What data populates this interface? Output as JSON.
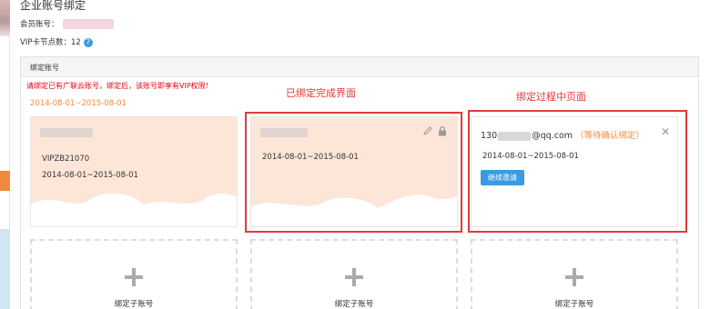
{
  "page_title": "企业账号绑定",
  "member": {
    "label": "会员账号："
  },
  "vip": {
    "label": "VIP卡节点数：12"
  },
  "panel": {
    "header": "绑定账号",
    "notice": "请绑定已有广联云账号，绑定后，该账号即享有VIP权限！",
    "range": "2014-08-01~2015-08-01"
  },
  "cards": {
    "vip_card": {
      "id": "VIPZB21070",
      "range": "2014-08-01~2015-08-01"
    },
    "bound_card": {
      "range": "2014-08-01~2015-08-01"
    },
    "pending_card": {
      "email_prefix": "130",
      "email_suffix": "@qq.com",
      "status": "（等待确认绑定）",
      "range": "2014-08-01~2015-08-01",
      "button": "继续邀请",
      "close": "✕"
    }
  },
  "add_cards": [
    {
      "label": "绑定子账号"
    },
    {
      "label": "绑定子账号"
    },
    {
      "label": "绑定子账号"
    }
  ],
  "annotations": {
    "done": "已绑定完成界面",
    "in_progress": "绑定过程中页面"
  },
  "colors": {
    "accent_orange": "#f08a3c",
    "notice_red": "#e60012",
    "button_blue": "#3b9ae1",
    "annotation_red": "#e03a3a",
    "card_peach": "#fde6d8"
  },
  "icons": [
    "help-icon",
    "pencil-icon",
    "lock-icon",
    "close-icon",
    "plus-icon"
  ]
}
